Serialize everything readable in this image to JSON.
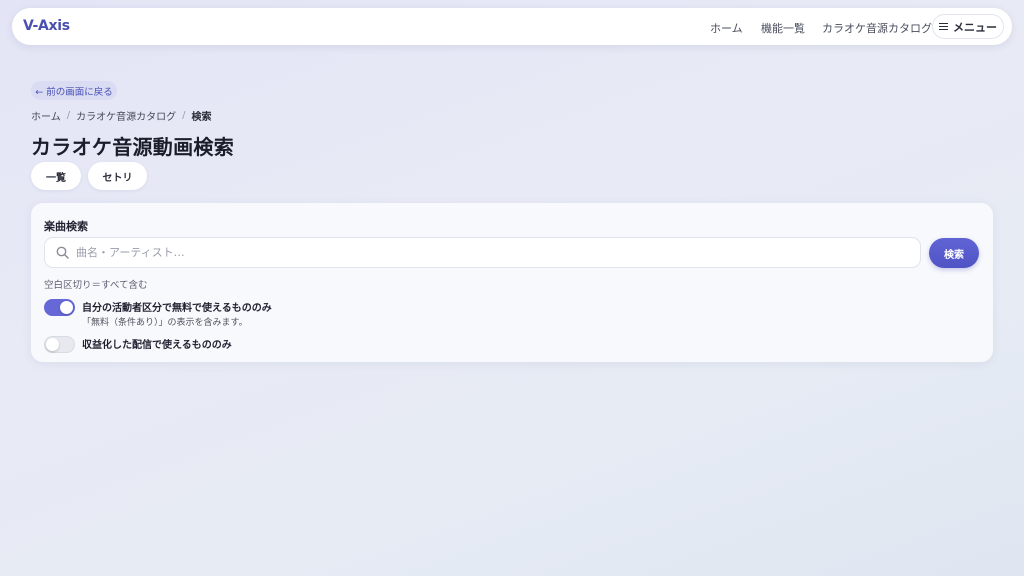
{
  "header": {
    "logo": "V-Axis",
    "nav": [
      "ホーム",
      "機能一覧",
      "カラオケ音源カタログ"
    ],
    "menu_label": "メニュー"
  },
  "back_button": "← 前の画面に戻る",
  "breadcrumb": [
    "ホーム",
    "カラオケ音源カタログ",
    "検索"
  ],
  "page_title": "カラオケ音源動画検索",
  "pills": [
    "一覧",
    "セトリ"
  ],
  "search_card": {
    "title": "楽曲検索",
    "placeholder": "曲名・アーティスト…",
    "value": "",
    "button": "検索",
    "hint": "空白区切り＝すべて含む",
    "toggles": [
      {
        "label": "自分の活動者区分で無料で使えるもののみ",
        "sub": "「無料（条件あり）」の表示を含みます。",
        "on": true
      },
      {
        "label": "収益化した配信で使えるもののみ",
        "sub": "",
        "on": false
      }
    ]
  },
  "colors": {
    "accent": "#5b5fd0",
    "logo": "#4b4fb0",
    "back_button_bg": "#d9dcf3"
  }
}
